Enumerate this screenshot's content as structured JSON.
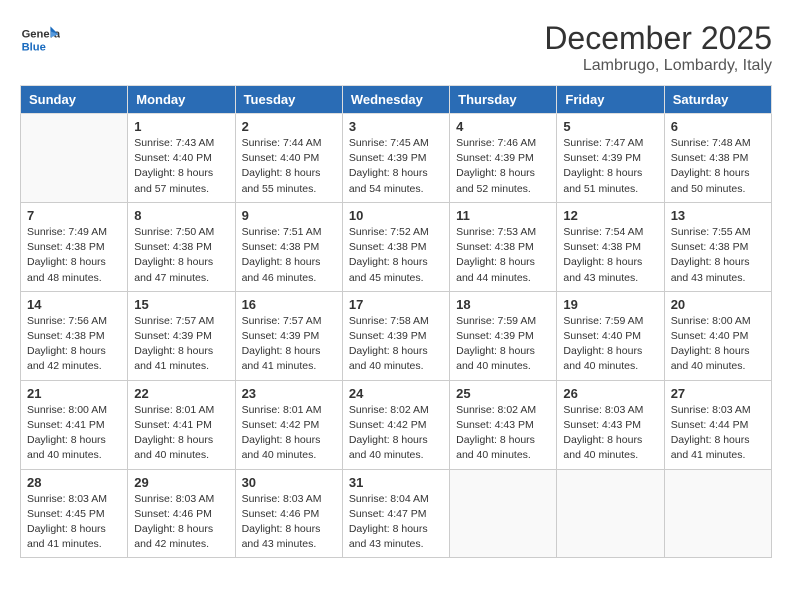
{
  "header": {
    "logo_line1": "General",
    "logo_line2": "Blue",
    "month": "December 2025",
    "location": "Lambrugo, Lombardy, Italy"
  },
  "days_of_week": [
    "Sunday",
    "Monday",
    "Tuesday",
    "Wednesday",
    "Thursday",
    "Friday",
    "Saturday"
  ],
  "weeks": [
    [
      {
        "day": "",
        "sunrise": "",
        "sunset": "",
        "daylight": ""
      },
      {
        "day": "1",
        "sunrise": "Sunrise: 7:43 AM",
        "sunset": "Sunset: 4:40 PM",
        "daylight": "Daylight: 8 hours and 57 minutes."
      },
      {
        "day": "2",
        "sunrise": "Sunrise: 7:44 AM",
        "sunset": "Sunset: 4:40 PM",
        "daylight": "Daylight: 8 hours and 55 minutes."
      },
      {
        "day": "3",
        "sunrise": "Sunrise: 7:45 AM",
        "sunset": "Sunset: 4:39 PM",
        "daylight": "Daylight: 8 hours and 54 minutes."
      },
      {
        "day": "4",
        "sunrise": "Sunrise: 7:46 AM",
        "sunset": "Sunset: 4:39 PM",
        "daylight": "Daylight: 8 hours and 52 minutes."
      },
      {
        "day": "5",
        "sunrise": "Sunrise: 7:47 AM",
        "sunset": "Sunset: 4:39 PM",
        "daylight": "Daylight: 8 hours and 51 minutes."
      },
      {
        "day": "6",
        "sunrise": "Sunrise: 7:48 AM",
        "sunset": "Sunset: 4:38 PM",
        "daylight": "Daylight: 8 hours and 50 minutes."
      }
    ],
    [
      {
        "day": "7",
        "sunrise": "Sunrise: 7:49 AM",
        "sunset": "Sunset: 4:38 PM",
        "daylight": "Daylight: 8 hours and 48 minutes."
      },
      {
        "day": "8",
        "sunrise": "Sunrise: 7:50 AM",
        "sunset": "Sunset: 4:38 PM",
        "daylight": "Daylight: 8 hours and 47 minutes."
      },
      {
        "day": "9",
        "sunrise": "Sunrise: 7:51 AM",
        "sunset": "Sunset: 4:38 PM",
        "daylight": "Daylight: 8 hours and 46 minutes."
      },
      {
        "day": "10",
        "sunrise": "Sunrise: 7:52 AM",
        "sunset": "Sunset: 4:38 PM",
        "daylight": "Daylight: 8 hours and 45 minutes."
      },
      {
        "day": "11",
        "sunrise": "Sunrise: 7:53 AM",
        "sunset": "Sunset: 4:38 PM",
        "daylight": "Daylight: 8 hours and 44 minutes."
      },
      {
        "day": "12",
        "sunrise": "Sunrise: 7:54 AM",
        "sunset": "Sunset: 4:38 PM",
        "daylight": "Daylight: 8 hours and 43 minutes."
      },
      {
        "day": "13",
        "sunrise": "Sunrise: 7:55 AM",
        "sunset": "Sunset: 4:38 PM",
        "daylight": "Daylight: 8 hours and 43 minutes."
      }
    ],
    [
      {
        "day": "14",
        "sunrise": "Sunrise: 7:56 AM",
        "sunset": "Sunset: 4:38 PM",
        "daylight": "Daylight: 8 hours and 42 minutes."
      },
      {
        "day": "15",
        "sunrise": "Sunrise: 7:57 AM",
        "sunset": "Sunset: 4:39 PM",
        "daylight": "Daylight: 8 hours and 41 minutes."
      },
      {
        "day": "16",
        "sunrise": "Sunrise: 7:57 AM",
        "sunset": "Sunset: 4:39 PM",
        "daylight": "Daylight: 8 hours and 41 minutes."
      },
      {
        "day": "17",
        "sunrise": "Sunrise: 7:58 AM",
        "sunset": "Sunset: 4:39 PM",
        "daylight": "Daylight: 8 hours and 40 minutes."
      },
      {
        "day": "18",
        "sunrise": "Sunrise: 7:59 AM",
        "sunset": "Sunset: 4:39 PM",
        "daylight": "Daylight: 8 hours and 40 minutes."
      },
      {
        "day": "19",
        "sunrise": "Sunrise: 7:59 AM",
        "sunset": "Sunset: 4:40 PM",
        "daylight": "Daylight: 8 hours and 40 minutes."
      },
      {
        "day": "20",
        "sunrise": "Sunrise: 8:00 AM",
        "sunset": "Sunset: 4:40 PM",
        "daylight": "Daylight: 8 hours and 40 minutes."
      }
    ],
    [
      {
        "day": "21",
        "sunrise": "Sunrise: 8:00 AM",
        "sunset": "Sunset: 4:41 PM",
        "daylight": "Daylight: 8 hours and 40 minutes."
      },
      {
        "day": "22",
        "sunrise": "Sunrise: 8:01 AM",
        "sunset": "Sunset: 4:41 PM",
        "daylight": "Daylight: 8 hours and 40 minutes."
      },
      {
        "day": "23",
        "sunrise": "Sunrise: 8:01 AM",
        "sunset": "Sunset: 4:42 PM",
        "daylight": "Daylight: 8 hours and 40 minutes."
      },
      {
        "day": "24",
        "sunrise": "Sunrise: 8:02 AM",
        "sunset": "Sunset: 4:42 PM",
        "daylight": "Daylight: 8 hours and 40 minutes."
      },
      {
        "day": "25",
        "sunrise": "Sunrise: 8:02 AM",
        "sunset": "Sunset: 4:43 PM",
        "daylight": "Daylight: 8 hours and 40 minutes."
      },
      {
        "day": "26",
        "sunrise": "Sunrise: 8:03 AM",
        "sunset": "Sunset: 4:43 PM",
        "daylight": "Daylight: 8 hours and 40 minutes."
      },
      {
        "day": "27",
        "sunrise": "Sunrise: 8:03 AM",
        "sunset": "Sunset: 4:44 PM",
        "daylight": "Daylight: 8 hours and 41 minutes."
      }
    ],
    [
      {
        "day": "28",
        "sunrise": "Sunrise: 8:03 AM",
        "sunset": "Sunset: 4:45 PM",
        "daylight": "Daylight: 8 hours and 41 minutes."
      },
      {
        "day": "29",
        "sunrise": "Sunrise: 8:03 AM",
        "sunset": "Sunset: 4:46 PM",
        "daylight": "Daylight: 8 hours and 42 minutes."
      },
      {
        "day": "30",
        "sunrise": "Sunrise: 8:03 AM",
        "sunset": "Sunset: 4:46 PM",
        "daylight": "Daylight: 8 hours and 43 minutes."
      },
      {
        "day": "31",
        "sunrise": "Sunrise: 8:04 AM",
        "sunset": "Sunset: 4:47 PM",
        "daylight": "Daylight: 8 hours and 43 minutes."
      },
      {
        "day": "",
        "sunrise": "",
        "sunset": "",
        "daylight": ""
      },
      {
        "day": "",
        "sunrise": "",
        "sunset": "",
        "daylight": ""
      },
      {
        "day": "",
        "sunrise": "",
        "sunset": "",
        "daylight": ""
      }
    ]
  ]
}
